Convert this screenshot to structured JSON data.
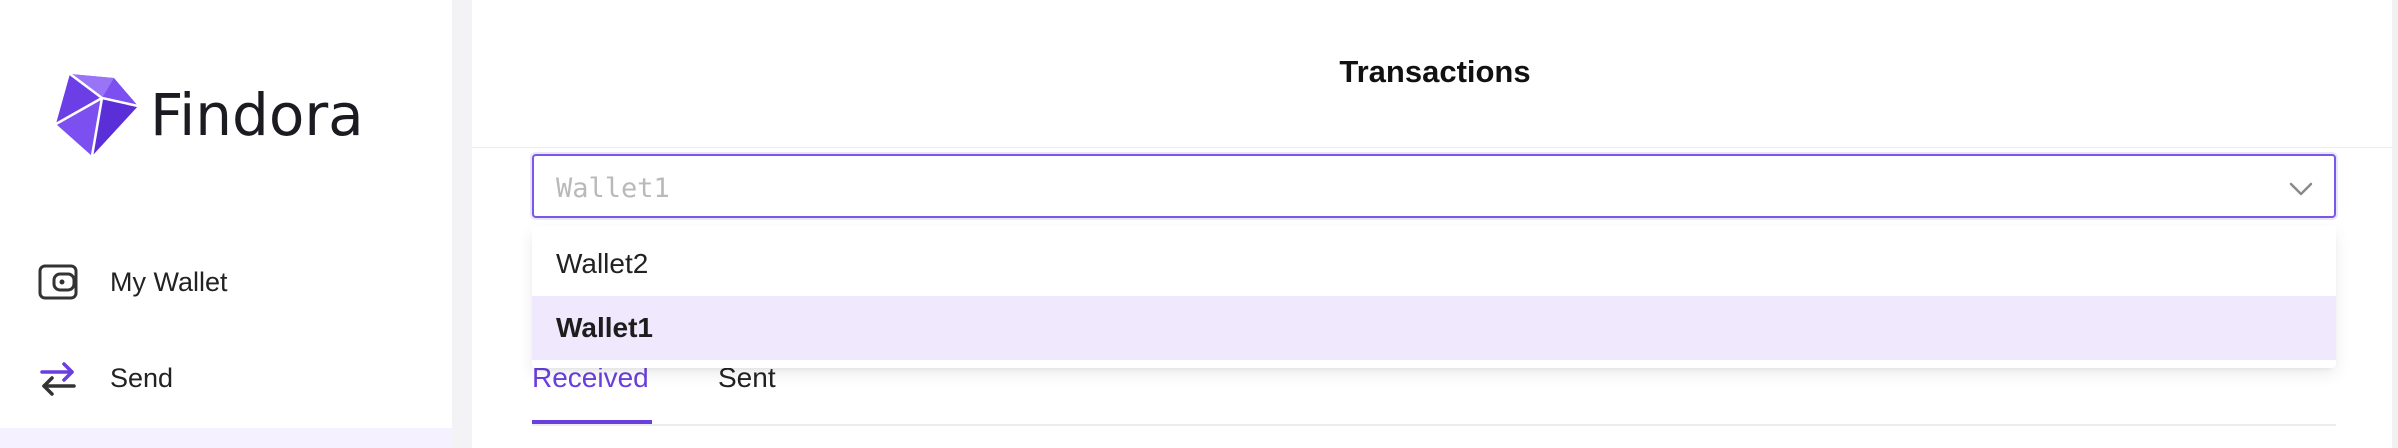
{
  "brand": {
    "name": "Findora",
    "accent_color": "#6a3fe0"
  },
  "sidebar": {
    "items": [
      {
        "label": "My Wallet",
        "icon": "wallet-icon"
      },
      {
        "label": "Send",
        "icon": "transfer-arrows-icon"
      }
    ]
  },
  "header": {
    "title": "Transactions"
  },
  "wallet_select": {
    "value": "Wallet1",
    "options": [
      {
        "label": "Wallet2",
        "selected": false
      },
      {
        "label": "Wallet1",
        "selected": true
      }
    ]
  },
  "tabs": [
    {
      "label": "Received",
      "active": true
    },
    {
      "label": "Sent",
      "active": false
    }
  ]
}
